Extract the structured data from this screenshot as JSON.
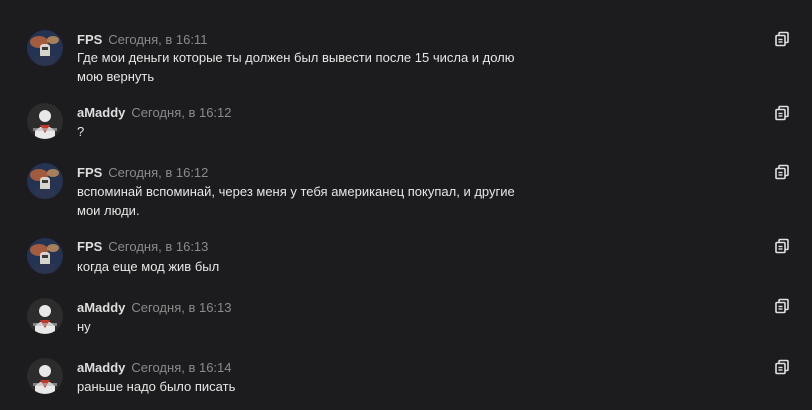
{
  "messages": [
    {
      "author": "FPS",
      "time": "Сегодня, в 16:11",
      "text": "Где мои деньги которые ты должен был вывести после 15 числа и долю мою вернуть",
      "avatar": "fps"
    },
    {
      "author": "aMaddy",
      "time": "Сегодня, в 16:12",
      "text": "?",
      "avatar": "amaddy"
    },
    {
      "author": "FPS",
      "time": "Сегодня, в 16:12",
      "text": "вспоминай вспоминай, через меня у тебя американец покупал, и другие мои люди.",
      "avatar": "fps"
    },
    {
      "author": "FPS",
      "time": "Сегодня, в 16:13",
      "text": "когда еще мод жив был",
      "avatar": "fps"
    },
    {
      "author": "aMaddy",
      "time": "Сегодня, в 16:13",
      "text": "ну",
      "avatar": "amaddy"
    },
    {
      "author": "aMaddy",
      "time": "Сегодня, в 16:14",
      "text": "раньше надо было писать",
      "avatar": "amaddy"
    }
  ],
  "icons": {
    "copy": "copy-icon"
  },
  "colors": {
    "background": "#1c1c1e",
    "author": "#dedede",
    "timestamp": "#8a8a8a",
    "text": "#e6e6e6"
  }
}
